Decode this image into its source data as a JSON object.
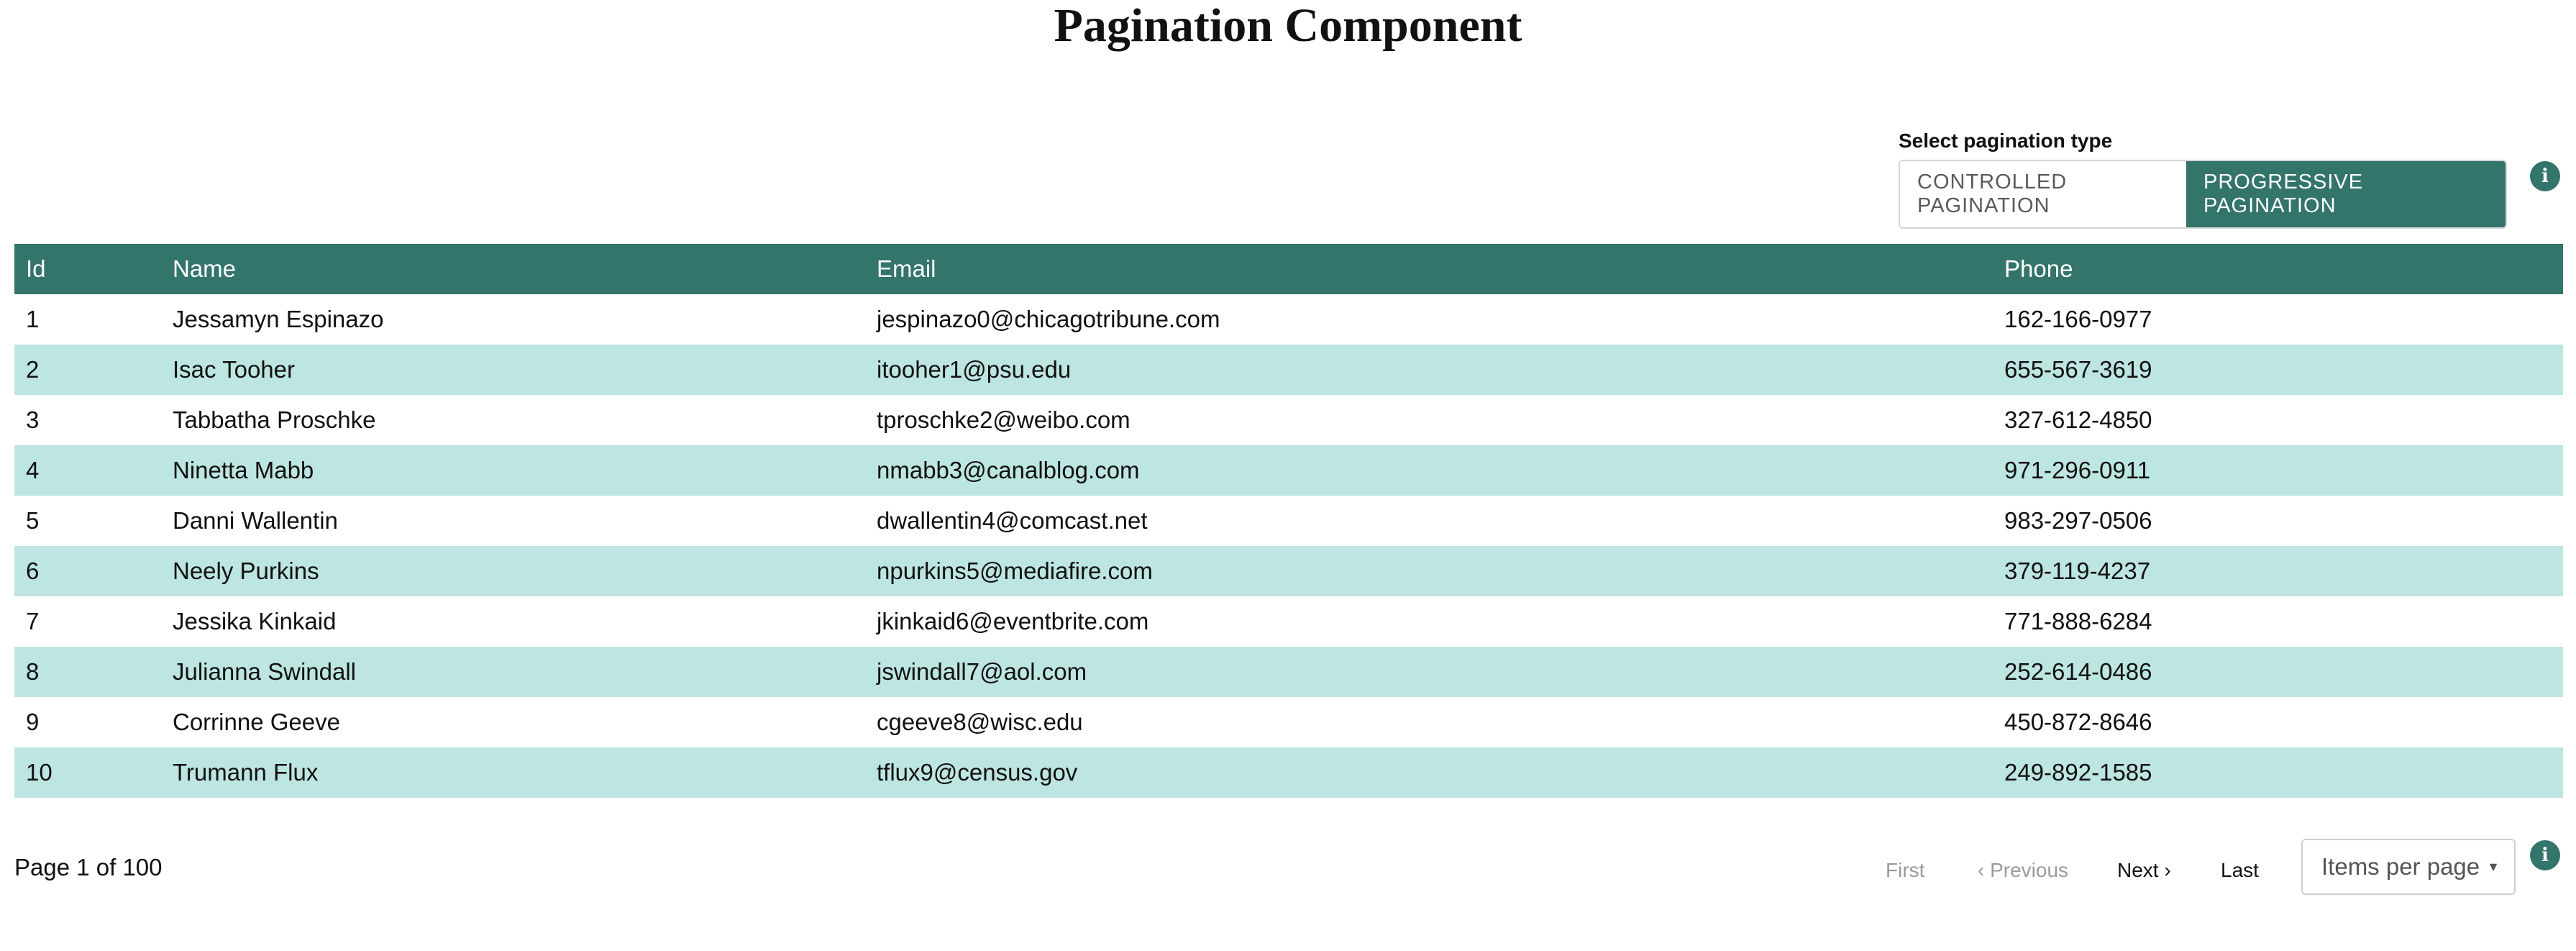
{
  "page": {
    "title": "Pagination Component"
  },
  "pagination_type": {
    "label": "Select pagination type",
    "options": [
      {
        "label": "CONTROLLED PAGINATION",
        "active": false
      },
      {
        "label": "PROGRESSIVE PAGINATION",
        "active": true
      }
    ]
  },
  "table": {
    "columns": [
      "Id",
      "Name",
      "Email",
      "Phone"
    ],
    "rows": [
      [
        "1",
        "Jessamyn Espinazo",
        "jespinazo0@chicagotribune.com",
        "162-166-0977"
      ],
      [
        "2",
        "Isac Tooher",
        "itooher1@psu.edu",
        "655-567-3619"
      ],
      [
        "3",
        "Tabbatha Proschke",
        "tproschke2@weibo.com",
        "327-612-4850"
      ],
      [
        "4",
        "Ninetta Mabb",
        "nmabb3@canalblog.com",
        "971-296-0911"
      ],
      [
        "5",
        "Danni Wallentin",
        "dwallentin4@comcast.net",
        "983-297-0506"
      ],
      [
        "6",
        "Neely Purkins",
        "npurkins5@mediafire.com",
        "379-119-4237"
      ],
      [
        "7",
        "Jessika Kinkaid",
        "jkinkaid6@eventbrite.com",
        "771-888-6284"
      ],
      [
        "8",
        "Julianna Swindall",
        "jswindall7@aol.com",
        "252-614-0486"
      ],
      [
        "9",
        "Corrinne Geeve",
        "cgeeve8@wisc.edu",
        "450-872-8646"
      ],
      [
        "10",
        "Trumann Flux",
        "tflux9@census.gov",
        "249-892-1585"
      ]
    ]
  },
  "footer": {
    "page_info": "Page 1 of 100",
    "first": "First",
    "previous": "Previous",
    "next": "Next",
    "last": "Last",
    "items_per_page": "Items per page",
    "info_icon": "i"
  },
  "colors": {
    "accent": "#33746b",
    "row_stripe": "#bde5e1"
  },
  "icons": {
    "info": "info-icon",
    "prev": "chevron-left-icon",
    "next": "chevron-right-icon",
    "dropdown": "caret-down-icon"
  }
}
